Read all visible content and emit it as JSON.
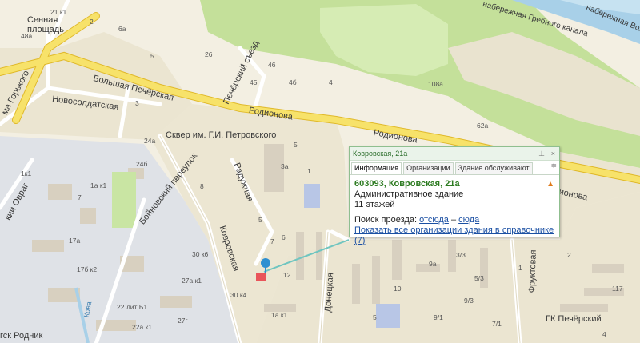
{
  "map": {
    "colors": {
      "background": "#f3efe2",
      "major_road": "#f7e26a",
      "minor_road": "#ffffff",
      "block": "#e9e3cf",
      "industrial": "#d9dde3",
      "park": "#c9e5a3",
      "forest": "#b9dc8f",
      "water": "#a8d0e8",
      "building": "#d8d0c0"
    },
    "labels": {
      "sennaya": "Сенная\nплощадь",
      "b_pecherskaya": "Большая Печёрская",
      "novosoldatskaya": "Новосолдатская",
      "rodionova1": "Родионова",
      "rodionova2": "Родионова",
      "pechersky_sezd": "Печёрский съезд",
      "skver": "Сквер им. Г.И. Петровского",
      "radugnaya": "Радужная",
      "boyhovsky": "Бойновский переулок",
      "kovrovskaya": "Ковровская",
      "donetskaya": "Донецкая",
      "fruktovaya": "Фруктовая",
      "gorkogo": "ма Горького",
      "ovrag": "кий Овраг",
      "rodnik": "гск Родник",
      "kova": "Кова",
      "grebnoy": "набережная Гребного канала",
      "volga": "набережная Волжская",
      "gk_pechersky": "ГК Печёрский",
      "ionova": "ионова"
    },
    "houses": [
      "21 к1",
      "2",
      "6а",
      "48а",
      "5",
      "3",
      "26",
      "46",
      "45",
      "4б",
      "108а",
      "62а",
      "4",
      "24а",
      "24б",
      "7",
      "3а",
      "1",
      "17а",
      "1к1",
      "1а к1",
      "17б к2",
      "30 к6",
      "27а к1",
      "30 к4",
      "8",
      "5",
      "7",
      "6",
      "5",
      "12",
      "10",
      "9а",
      "3/3",
      "5/3",
      "9/3",
      "117",
      "2",
      "9/1",
      "7/1",
      "5",
      "1а к1",
      "22 лит Б1",
      "22а к1",
      "27г",
      "1",
      "4"
    ]
  },
  "popup": {
    "title": "Ковровская, 21а",
    "tabs": [
      "Информация",
      "Организации",
      "Здание обслуживают"
    ],
    "address": "603093, Ковровская, 21а",
    "type": "Административное здание",
    "floors": "11 этажей",
    "route_label": "Поиск проезда:",
    "from_here": "отсюда",
    "dash": "–",
    "to_here": "сюда",
    "show_all": "Показать все организации здания в справочнике",
    "count": "(7)"
  }
}
